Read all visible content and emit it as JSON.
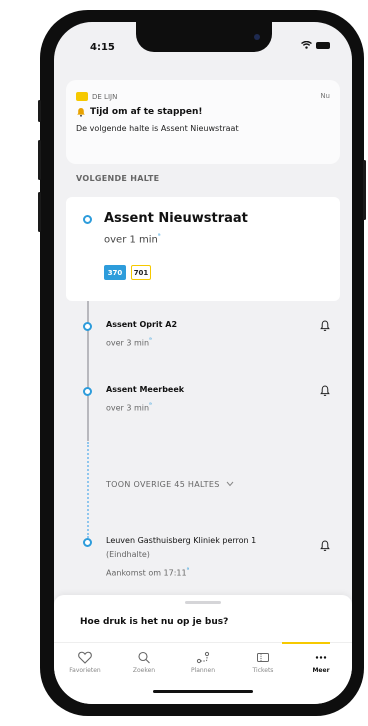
{
  "status_bar": {
    "time": "4:15"
  },
  "notification": {
    "app_name": "DE LIJN",
    "time": "Nu",
    "title": "Tijd om af te stappen!",
    "body": "De volgende halte is Assent Nieuwstraat"
  },
  "section_label": "VOLGENDE HALTE",
  "next_stop": {
    "name": "Assent Nieuwstraat",
    "eta": "over 1 min",
    "lines": [
      "370",
      "701"
    ]
  },
  "stops": [
    {
      "name": "Assent Oprit A2",
      "eta": "over 3 min"
    },
    {
      "name": "Assent Meerbeek",
      "eta": "over 3 min"
    }
  ],
  "show_more_label": "TOON OVERIGE 45 HALTES",
  "final_stop": {
    "name": "Leuven Gasthuisberg Kliniek perron 1",
    "subtitle": "(Eindhalte)",
    "arrival": "Aankomst om 17:11"
  },
  "sheet_title": "Hoe druk is het nu op je bus?",
  "tabs": [
    {
      "label": "Favorieten",
      "icon": "heart-icon"
    },
    {
      "label": "Zoeken",
      "icon": "search-icon"
    },
    {
      "label": "Plannen",
      "icon": "route-icon"
    },
    {
      "label": "Tickets",
      "icon": "ticket-icon"
    },
    {
      "label": "Meer",
      "icon": "more-icon"
    }
  ],
  "colors": {
    "accent_yellow": "#f6c900",
    "accent_blue": "#2d9cdb"
  }
}
